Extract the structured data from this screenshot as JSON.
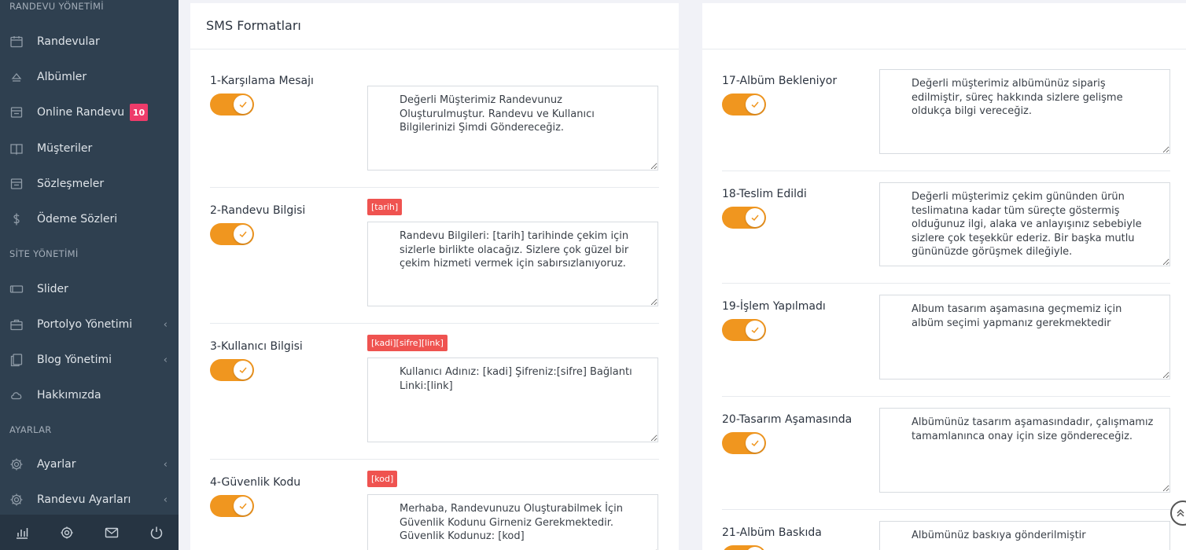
{
  "sidebar": {
    "sections": {
      "randevu": "RANDEVU YÖNETİMİ",
      "site": "SİTE YÖNETİMİ",
      "ayarlar": "AYARLAR"
    },
    "items": {
      "randevular": "Randevular",
      "albumler": "Albümler",
      "online_randevu": "Online Randevu",
      "online_badge": "10",
      "musteriler": "Müşteriler",
      "sozlesmeler": "Sözleşmeler",
      "odeme": "Ödeme Sözleri",
      "slider": "Slider",
      "portfolyo": "Portolyo Yönetimi",
      "blog": "Blog Yönetimi",
      "hakkimizda": "Hakkımızda",
      "ayarlar": "Ayarlar",
      "randevu_ayarlari": "Randevu Ayarları"
    },
    "arrow": "‹"
  },
  "left_panel": {
    "title": "SMS Formatları",
    "rows": [
      {
        "label": "1-Karşılama Mesajı",
        "tag": "",
        "text": "Değerli Müşterimiz Randevunuz Oluşturulmuştur. Randevu ve Kullanıcı Bilgilerinizi Şimdi Göndereceğiz."
      },
      {
        "label": "2-Randevu Bilgisi",
        "tag": "[tarih]",
        "text": "Randevu Bilgileri: [tarih] tarihinde çekim için sizlerle birlikte olacağız. Sizlere çok güzel bir çekim hizmeti vermek için sabırsızlanıyoruz."
      },
      {
        "label": "3-Kullanıcı Bilgisi",
        "tag": "[kadi][sifre][link]",
        "text": "Kullanıcı Adınız: [kadi] Şifreniz:[sifre] Bağlantı Linki:[link]"
      },
      {
        "label": "4-Güvenlik Kodu",
        "tag": "[kod]",
        "text": "Merhaba, Randevunuzu Oluşturabilmek İçin Güvenlik Kodunu Girneniz Gerekmektedir. Güvenlik Kodunuz: [kod]"
      }
    ]
  },
  "right_panel": {
    "rows": [
      {
        "label": "17-Albüm Bekleniyor",
        "text": "Değerli müşterimiz albümünüz sipariş edilmiştir, süreç hakkında sizlere gelişme oldukça bilgi vereceğiz."
      },
      {
        "label": "18-Teslim Edildi",
        "text": "Değerli müşterimiz çekim gününden ürün teslimatına kadar tüm süreçte göstermiş olduğunuz ilgi, alaka ve anlayışınız sebebiyle sizlere çok teşekkür ederiz. Bir başka mutlu gününüzde görüşmek dileğiyle."
      },
      {
        "label": "19-İşlem Yapılmadı",
        "text": "Album tasarım aşamasına geçmemiz için albüm seçimi yapmanız gerekmektedir"
      },
      {
        "label": "20-Tasarım Aşamasında",
        "text": "Albümünüz tasarım aşamasındadır, çalışmamız tamamlanınca onay için size göndereceğiz."
      },
      {
        "label": "21-Albüm Baskıda",
        "text": "Albümünüz baskıya gönderilmiştir"
      }
    ]
  },
  "colors": {
    "sidebar_bg": "#2f4050",
    "toggle_on": "#f0961f",
    "tag_bg": "#ef5350",
    "badge_bg": "#ee3b6a"
  }
}
